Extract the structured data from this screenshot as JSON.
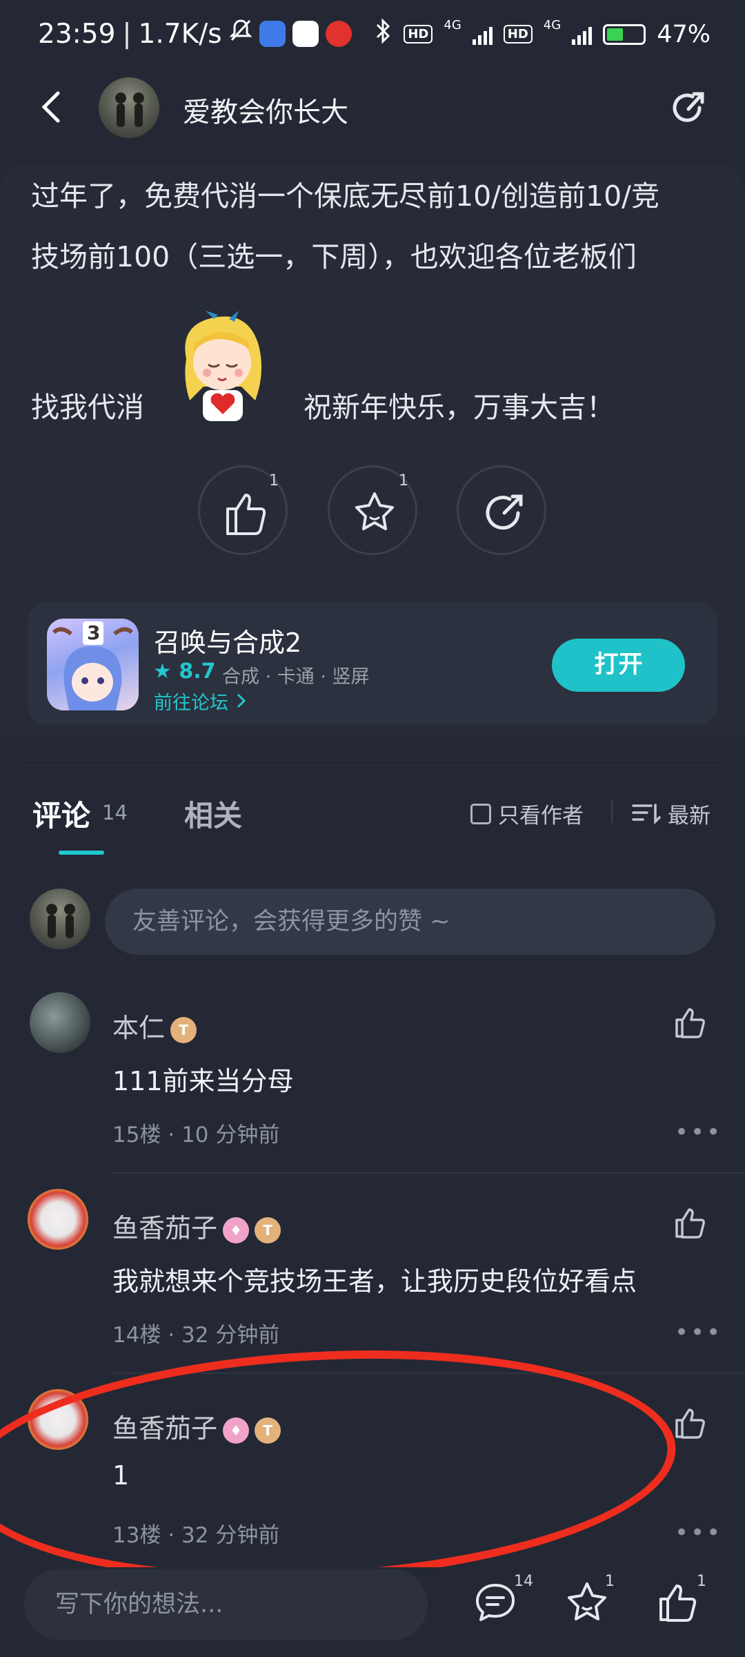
{
  "status_bar": {
    "time": "23:59",
    "net_speed": "1.7K/s",
    "signal_1": "4G",
    "signal_2": "4G",
    "battery": "47%"
  },
  "header": {
    "author_name": "爱教会你长大"
  },
  "post": {
    "line1": "过年了，免费代消一个保底无尽前10/创造前10/竞",
    "line2": "技场前100（三选一，下周），也欢迎各位老板们",
    "line3_left": "找我代消",
    "line3_right": "祝新年快乐，万事大吉！",
    "actions": {
      "like_count": "1",
      "favorite_count": "1"
    }
  },
  "app_card": {
    "icon_number": "3",
    "name": "召唤与合成2",
    "rating": "8.7",
    "tags": "合成 · 卡通 · 竖屏",
    "forum_link": "前往论坛",
    "open_label": "打开"
  },
  "comments": {
    "tab_comments_label": "评论",
    "tab_comments_count": "14",
    "tab_related_label": "相关",
    "author_only_label": "只看作者",
    "sort_label": "最新",
    "input_placeholder": "友善评论，会获得更多的赞 ~",
    "items": [
      {
        "name": "本仁",
        "text": "111前来当分母",
        "floor": "15楼",
        "time": "10 分钟前"
      },
      {
        "name": "鱼香茄子",
        "text": "我就想来个竞技场王者，让我历史段位好看点",
        "floor": "14楼",
        "time": "32 分钟前"
      },
      {
        "name": "鱼香茄子",
        "text": "1",
        "floor": "13楼",
        "time": "32 分钟前"
      }
    ],
    "meta_sep": " · "
  },
  "bottom_bar": {
    "input_placeholder": "写下你的想法...",
    "comment_count": "14",
    "favorite_count": "1",
    "like_count": "1"
  },
  "colors": {
    "background": "#232834",
    "accent": "#1fc2c9",
    "highlight": "#ee2d1f"
  },
  "icons": [
    "back-arrow-icon",
    "share-icon",
    "thumbs-up-icon",
    "star-icon",
    "chevron-right-icon",
    "sort-icon",
    "more-dots-icon",
    "comment-bubble-icon"
  ]
}
